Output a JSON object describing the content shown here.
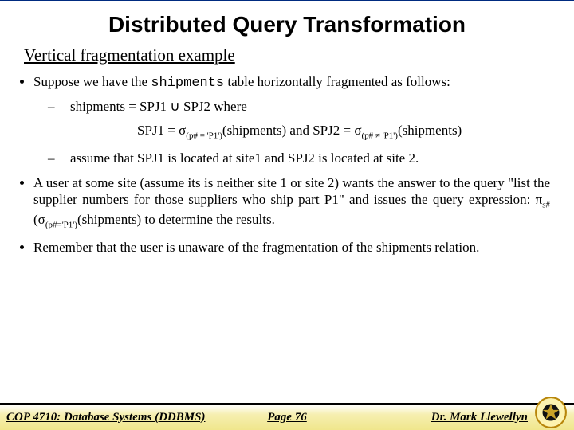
{
  "title": "Distributed Query Transformation",
  "subtitle": "Vertical fragmentation example",
  "bullet1_a": "Suppose we have the ",
  "bullet1_code": "shipments",
  "bullet1_b": " table horizontally fragmented as follows:",
  "sub1": "shipments = SPJ1 ∪ SPJ2 where",
  "formula_a": "SPJ1 = σ",
  "formula_sub1": "(p# = 'P1')",
  "formula_b": "(shipments)  and SPJ2 = σ",
  "formula_sub2": "(p# ≠ 'P1')",
  "formula_c": "(shipments)",
  "sub2": "assume that SPJ1 is located at site1 and SPJ2 is located at site 2.",
  "bullet2_a": "A user at some site (assume its is neither site 1 or site 2) wants the answer to the query \"list the supplier numbers for those suppliers who ship part P1\" and issues the query expression: π",
  "bullet2_sub1": "s#",
  "bullet2_b": "(σ",
  "bullet2_sub2": "(p#='P1')",
  "bullet2_c": "(shipments) to determine the results.",
  "bullet3": "Remember that the user is unaware of the fragmentation of the shipments relation.",
  "footer_left": "COP 4710: Database Systems (DDBMS)",
  "footer_center": "Page 76",
  "footer_right": "Dr. Mark Llewellyn"
}
